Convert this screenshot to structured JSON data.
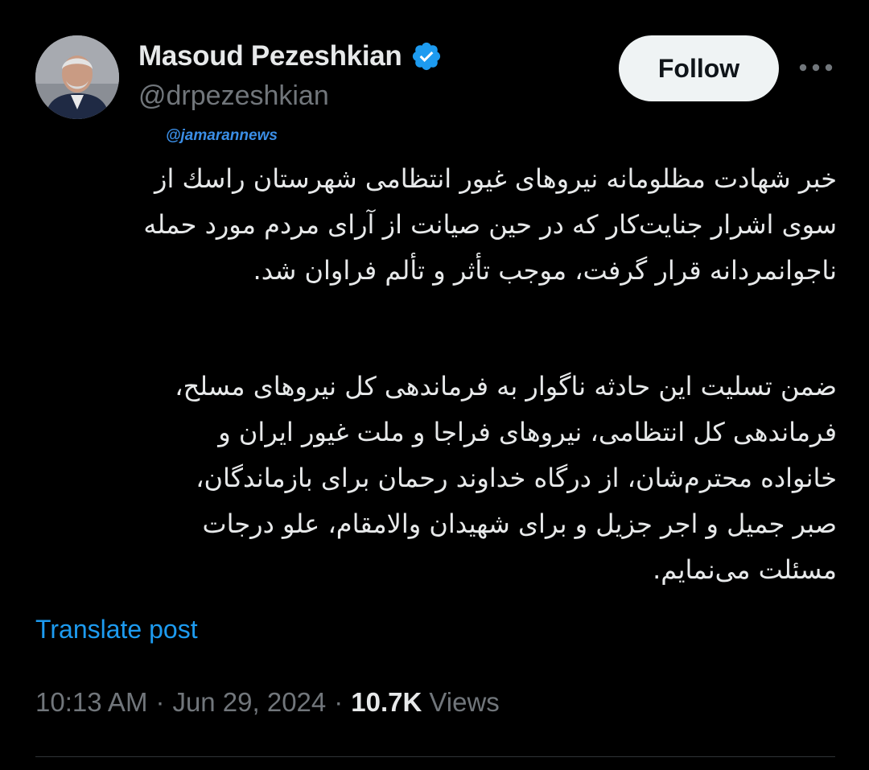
{
  "author": {
    "display_name": "Masoud Pezeshkian",
    "handle": "@drpezeshkian",
    "verified_color": "#1d9bf0"
  },
  "actions": {
    "follow_label": "Follow",
    "more_icon": "more-horizontal-icon"
  },
  "attribution": "@jamarannews",
  "tweet": {
    "paragraph_1": [
      "خبر شهادت مظلومانه نیروهای غیور انتظامی شهرستان راسك از",
      "سوی اشرار جنایت‌کار که در حین صیانت از آرای مردم مورد حمله",
      "ناجوانمردانه قرار گرفت، موجب تأثر و تألم فراوان شد."
    ],
    "paragraph_2": [
      "ضمن تسلیت این حادثه ناگوار به فرماندهی کل نیروهای مسلح،",
      "فرماندهی کل انتظامی، نیروهای فراجا و ملت غیور ایران و",
      "خانواده محترم‌شان، از درگاه خداوند رحمان برای بازماندگان،",
      "صبر جمیل و اجر جزیل و برای شهیدان والامقام، علو درجات",
      "مسئلت می‌نمایم."
    ]
  },
  "translate_label": "Translate post",
  "meta": {
    "time": "10:13 AM",
    "separator": "·",
    "date": "Jun 29, 2024",
    "views_count": "10.7K",
    "views_label": "Views"
  },
  "colors": {
    "background": "#000000",
    "text": "#e7e9ea",
    "muted": "#71767b",
    "link": "#1d9bf0",
    "divider": "#2f3336"
  }
}
